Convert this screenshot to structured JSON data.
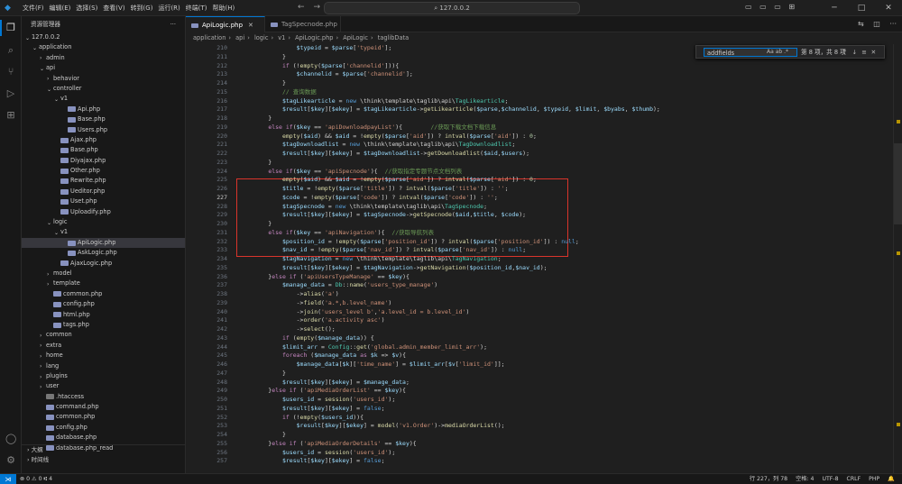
{
  "menu": [
    "文件(F)",
    "编辑(E)",
    "选择(S)",
    "查看(V)",
    "转到(G)",
    "运行(R)",
    "终端(T)",
    "帮助(H)"
  ],
  "search_text": "127.0.0.2",
  "sidebar": {
    "title": "资源管理器",
    "outline_label": "大纲",
    "timeline_label": "时间线",
    "tree": [
      {
        "label": "127.0.0.2",
        "depth": 0,
        "type": "folder",
        "open": true
      },
      {
        "label": "application",
        "depth": 1,
        "type": "folder",
        "open": true
      },
      {
        "label": "admin",
        "depth": 2,
        "type": "folder",
        "open": false
      },
      {
        "label": "api",
        "depth": 2,
        "type": "folder",
        "open": true
      },
      {
        "label": "behavior",
        "depth": 3,
        "type": "folder",
        "open": false
      },
      {
        "label": "controller",
        "depth": 3,
        "type": "folder",
        "open": true
      },
      {
        "label": "v1",
        "depth": 4,
        "type": "folder",
        "open": true
      },
      {
        "label": "Api.php",
        "depth": 5,
        "type": "php"
      },
      {
        "label": "Base.php",
        "depth": 5,
        "type": "php"
      },
      {
        "label": "Users.php",
        "depth": 5,
        "type": "php"
      },
      {
        "label": "Ajax.php",
        "depth": 4,
        "type": "php"
      },
      {
        "label": "Base.php",
        "depth": 4,
        "type": "php"
      },
      {
        "label": "Diyajax.php",
        "depth": 4,
        "type": "php"
      },
      {
        "label": "Other.php",
        "depth": 4,
        "type": "php"
      },
      {
        "label": "Rewrite.php",
        "depth": 4,
        "type": "php"
      },
      {
        "label": "Ueditor.php",
        "depth": 4,
        "type": "php"
      },
      {
        "label": "Uset.php",
        "depth": 4,
        "type": "php"
      },
      {
        "label": "Uploadify.php",
        "depth": 4,
        "type": "php"
      },
      {
        "label": "logic",
        "depth": 3,
        "type": "folder",
        "open": true
      },
      {
        "label": "v1",
        "depth": 4,
        "type": "folder",
        "open": true
      },
      {
        "label": "ApiLogic.php",
        "depth": 5,
        "type": "php",
        "selected": true
      },
      {
        "label": "AskLogic.php",
        "depth": 5,
        "type": "php"
      },
      {
        "label": "AjaxLogic.php",
        "depth": 4,
        "type": "php"
      },
      {
        "label": "model",
        "depth": 3,
        "type": "folder",
        "open": false
      },
      {
        "label": "template",
        "depth": 3,
        "type": "folder",
        "open": false
      },
      {
        "label": "common.php",
        "depth": 3,
        "type": "php"
      },
      {
        "label": "config.php",
        "depth": 3,
        "type": "php"
      },
      {
        "label": "html.php",
        "depth": 3,
        "type": "php"
      },
      {
        "label": "tags.php",
        "depth": 3,
        "type": "php"
      },
      {
        "label": "common",
        "depth": 2,
        "type": "folder",
        "open": false
      },
      {
        "label": "extra",
        "depth": 2,
        "type": "folder",
        "open": false
      },
      {
        "label": "home",
        "depth": 2,
        "type": "folder",
        "open": false
      },
      {
        "label": "lang",
        "depth": 2,
        "type": "folder",
        "open": false
      },
      {
        "label": "plugins",
        "depth": 2,
        "type": "folder",
        "open": false
      },
      {
        "label": "user",
        "depth": 2,
        "type": "folder",
        "open": false
      },
      {
        "label": ".htaccess",
        "depth": 2,
        "type": "ht"
      },
      {
        "label": "command.php",
        "depth": 2,
        "type": "php"
      },
      {
        "label": "common.php",
        "depth": 2,
        "type": "php"
      },
      {
        "label": "config.php",
        "depth": 2,
        "type": "php"
      },
      {
        "label": "database.php",
        "depth": 2,
        "type": "php"
      },
      {
        "label": "database.php_read",
        "depth": 2,
        "type": "php"
      }
    ]
  },
  "tabs": [
    {
      "label": "ApiLogic.php",
      "active": true
    },
    {
      "label": "TagSpecnode.php",
      "active": false
    }
  ],
  "breadcrumb": [
    "application",
    "api",
    "logic",
    "v1",
    "ApiLogic.php",
    "ApiLogic",
    "taglibData"
  ],
  "find": {
    "query": "addfields",
    "options": "Aa ab .*",
    "result": "第 8 项，共 8 项"
  },
  "code_lines": [
    {
      "n": "210",
      "h": "                <span class='v'>$typeid</span> = <span class='v'>$parse</span>[<span class='s'>'typeid'</span>];"
    },
    {
      "n": "211",
      "h": "            }"
    },
    {
      "n": "212",
      "h": "            <span class='k'>if</span> (!<span class='f'>empty</span>(<span class='v'>$parse</span>[<span class='s'>'channelid'</span>])){"
    },
    {
      "n": "213",
      "h": "                <span class='v'>$channelid</span> = <span class='v'>$parse</span>[<span class='s'>'channelid'</span>];"
    },
    {
      "n": "214",
      "h": "            }"
    },
    {
      "n": "215",
      "h": "            <span class='c'>// 查询数据</span>"
    },
    {
      "n": "216",
      "h": "            <span class='v'>$tagLikearticle</span> = <span class='b'>new</span> \\think\\template\\taglib\\api\\<span class='cl'>TagLikearticle</span>;"
    },
    {
      "n": "217",
      "h": "            <span class='v'>$result</span>[<span class='v'>$key</span>][<span class='v'>$ekey</span>] = <span class='v'>$tagLikearticle</span>-&gt;<span class='f'>getLikearticle</span>(<span class='v'>$parse</span>,<span class='v'>$channelid</span>, <span class='v'>$typeid</span>, <span class='v'>$limit</span>, <span class='v'>$byabs</span>, <span class='v'>$thumb</span>);"
    },
    {
      "n": "218",
      "h": "        }"
    },
    {
      "n": "219",
      "h": "        <span class='k'>else if</span>(<span class='v'>$key</span> == <span class='s'>'apiDownloadpayList'</span>){        <span class='c'>//获取下载文档下载信息</span>"
    },
    {
      "n": "220",
      "h": "            <span class='f'>empty</span>(<span class='v'>$aid</span>) &amp;&amp; <span class='v'>$aid</span> = !<span class='f'>empty</span>(<span class='v'>$parse</span>[<span class='s'>'aid'</span>]) ? <span class='f'>intval</span>(<span class='v'>$parse</span>[<span class='s'>'aid'</span>]) : <span class='n'>0</span>;"
    },
    {
      "n": "221",
      "h": "            <span class='v'>$tagDownloadlist</span> = <span class='b'>new</span> \\think\\template\\taglib\\api\\<span class='cl'>TagDownloadlist</span>;"
    },
    {
      "n": "222",
      "h": "            <span class='v'>$result</span>[<span class='v'>$key</span>][<span class='v'>$ekey</span>] = <span class='v'>$tagDownloadlist</span>-&gt;<span class='f'>getDownloadlist</span>(<span class='v'>$aid</span>,<span class='v'>$users</span>);"
    },
    {
      "n": "223",
      "h": "        }"
    },
    {
      "n": "224",
      "h": "        <span class='k'>else if</span>(<span class='v'>$key</span> == <span class='s'>'apiSpecnode'</span>){  <span class='c'>//获取指定专题节点文档列表</span>"
    },
    {
      "n": "225",
      "h": "            <span class='f'>empty</span>(<span class='v'>$aid</span>) &amp;&amp; <span class='v'>$aid</span> = !<span class='f'>empty</span>(<span class='v'>$parse</span>[<span class='s'>'aid'</span>]) ? <span class='f'>intval</span>(<span class='v'>$parse</span>[<span class='s'>'aid'</span>]) : <span class='n'>0</span>;"
    },
    {
      "n": "226",
      "h": "            <span class='v'>$title</span> = !<span class='f'>empty</span>(<span class='v'>$parse</span>[<span class='s'>'title'</span>]) ? <span class='f'>intval</span>(<span class='v'>$parse</span>[<span class='s'>'title'</span>]) : <span class='s'>''</span>;"
    },
    {
      "n": "227",
      "h": "            <span class='v'>$code</span> = !<span class='f'>empty</span>(<span class='v'>$parse</span>[<span class='s'>'code'</span>]) ? <span class='f'>intval</span>(<span class='v'>$parse</span>[<span class='s'>'code'</span>]) : <span class='s'>''</span>;"
    },
    {
      "n": "228",
      "h": "            <span class='v'>$tagSpecnode</span> = <span class='b'>new</span> \\think\\template\\taglib\\api\\<span class='cl'>TagSpecnode</span>;"
    },
    {
      "n": "229",
      "h": "            <span class='v'>$result</span>[<span class='v'>$key</span>][<span class='v'>$ekey</span>] = <span class='v'>$tagSpecnode</span>-&gt;<span class='f'>getSpecnode</span>(<span class='v'>$aid</span>,<span class='v'>$title</span>, <span class='v'>$code</span>);"
    },
    {
      "n": "230",
      "h": "        }"
    },
    {
      "n": "231",
      "h": "        <span class='k'>else if</span>(<span class='v'>$key</span> == <span class='s'>'apiNavigation'</span>){  <span class='c'>//获取导航列表</span>"
    },
    {
      "n": "232",
      "h": "            <span class='v'>$position_id</span> = !<span class='f'>empty</span>(<span class='v'>$parse</span>[<span class='s'>'position_id'</span>]) ? <span class='f'>intval</span>(<span class='v'>$parse</span>[<span class='s'>'position_id'</span>]) : <span class='b'>null</span>;"
    },
    {
      "n": "233",
      "h": "            <span class='v'>$nav_id</span> = !<span class='f'>empty</span>(<span class='v'>$parse</span>[<span class='s'>'nav_id'</span>]) ? <span class='f'>intval</span>(<span class='v'>$parse</span>[<span class='s'>'nav_id'</span>]) : <span class='b'>null</span>;"
    },
    {
      "n": "234",
      "h": "            <span class='v'>$tagNavigation</span> = <span class='b'>new</span> \\think\\template\\taglib\\api\\<span class='cl'>TagNavigation</span>;"
    },
    {
      "n": "235",
      "h": "            <span class='v'>$result</span>[<span class='v'>$key</span>][<span class='v'>$ekey</span>] = <span class='v'>$tagNavigation</span>-&gt;<span class='f'>getNavigation</span>(<span class='v'>$position_id</span>,<span class='v'>$nav_id</span>);"
    },
    {
      "n": "236",
      "h": "        }<span class='k'>else if</span> (<span class='s'>'apiUsersTypeManage'</span> == <span class='v'>$key</span>){"
    },
    {
      "n": "237",
      "h": "            <span class='v'>$manage_data</span> = <span class='cl'>Db</span>::<span class='f'>name</span>(<span class='s'>'users_type_manage'</span>)"
    },
    {
      "n": "238",
      "h": "                -&gt;<span class='f'>alias</span>(<span class='s'>'a'</span>)"
    },
    {
      "n": "239",
      "h": "                -&gt;<span class='f'>field</span>(<span class='s'>'a.*,b.level_name'</span>)"
    },
    {
      "n": "240",
      "h": "                -&gt;<span class='f'>join</span>(<span class='s'>'users_level b'</span>,<span class='s'>'a.level_id = b.level_id'</span>)"
    },
    {
      "n": "241",
      "h": "                -&gt;<span class='f'>order</span>(<span class='s'>'a.activity asc'</span>)"
    },
    {
      "n": "242",
      "h": "                -&gt;<span class='f'>select</span>();"
    },
    {
      "n": "243",
      "h": "            <span class='k'>if</span> (<span class='f'>empty</span>(<span class='v'>$manage_data</span>)) {"
    },
    {
      "n": "244",
      "h": "            <span class='v'>$limit_arr</span> = <span class='cl'>Config</span>::<span class='f'>get</span>(<span class='s'>'global.admin_member_limit_arr'</span>);"
    },
    {
      "n": "245",
      "h": "            <span class='k'>foreach</span> (<span class='v'>$manage_data</span> <span class='k'>as</span> <span class='v'>$k</span> =&gt; <span class='v'>$v</span>){"
    },
    {
      "n": "246",
      "h": "                <span class='v'>$manage_data</span>[<span class='v'>$k</span>][<span class='s'>'time_name'</span>] = <span class='v'>$limit_arr</span>[<span class='v'>$v</span>[<span class='s'>'limit_id'</span>]];"
    },
    {
      "n": "247",
      "h": "            }"
    },
    {
      "n": "248",
      "h": "            <span class='v'>$result</span>[<span class='v'>$key</span>][<span class='v'>$ekey</span>] = <span class='v'>$manage_data</span>;"
    },
    {
      "n": "249",
      "h": "        }<span class='k'>else if</span> (<span class='s'>'apiMediaOrderList'</span> == <span class='v'>$key</span>){"
    },
    {
      "n": "250",
      "h": "            <span class='v'>$users_id</span> = <span class='f'>session</span>(<span class='s'>'users_id'</span>);"
    },
    {
      "n": "251",
      "h": "            <span class='v'>$result</span>[<span class='v'>$key</span>][<span class='v'>$ekey</span>] = <span class='b'>false</span>;"
    },
    {
      "n": "252",
      "h": "            <span class='k'>if</span> (!<span class='f'>empty</span>(<span class='v'>$users_id</span>)){"
    },
    {
      "n": "253",
      "h": "                <span class='v'>$result</span>[<span class='v'>$key</span>][<span class='v'>$ekey</span>] = <span class='f'>model</span>(<span class='s'>'v1.Order'</span>)-&gt;<span class='f'>mediaOrderList</span>();"
    },
    {
      "n": "254",
      "h": "            }"
    },
    {
      "n": "255",
      "h": "        }<span class='k'>else if</span> (<span class='s'>'apiMediaOrderDetails'</span> == <span class='v'>$key</span>){"
    },
    {
      "n": "256",
      "h": "            <span class='v'>$users_id</span> = <span class='f'>session</span>(<span class='s'>'users_id'</span>);"
    },
    {
      "n": "257",
      "h": "            <span class='v'>$result</span>[<span class='v'>$key</span>][<span class='v'>$ekey</span>] = <span class='b'>false</span>;"
    }
  ],
  "current_line": "227",
  "status": {
    "left": "⊗ 0  ⚠ 0  ⑆ 4",
    "position": "行 227，列 78",
    "spaces": "空格: 4",
    "encoding": "UTF-8",
    "eol": "CRLF",
    "language": "PHP"
  },
  "colors": {
    "accent": "#0078d4",
    "highlight_box": "#d9342b"
  }
}
